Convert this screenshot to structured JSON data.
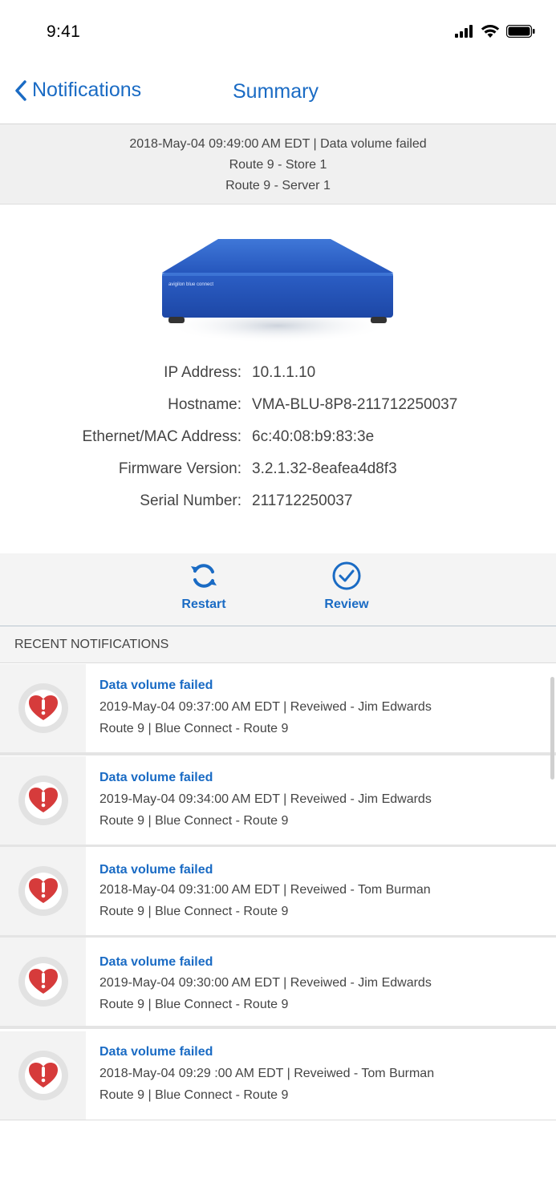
{
  "status_bar": {
    "time": "9:41"
  },
  "nav": {
    "back_label": "Notifications",
    "title": "Summary"
  },
  "summary": {
    "line1": "2018-May-04 09:49:00 AM EDT | Data volume failed",
    "line2": "Route 9 - Store 1",
    "line3": "Route 9 - Server 1"
  },
  "device": {
    "brand_text": "avigilon blue connect",
    "fields": [
      {
        "label": "IP Address:",
        "value": "10.1.1.10"
      },
      {
        "label": "Hostname:",
        "value": "VMA-BLU-8P8-211712250037"
      },
      {
        "label": "Ethernet/MAC Address:",
        "value": "6c:40:08:b9:83:3e"
      },
      {
        "label": "Firmware Version:",
        "value": "3.2.1.32-8eafea4d8f3"
      },
      {
        "label": "Serial Number:",
        "value": "211712250037"
      }
    ]
  },
  "actions": {
    "restart_label": "Restart",
    "review_label": "Review"
  },
  "recent": {
    "header": "RECENT NOTIFICATIONS",
    "items": [
      {
        "title": "Data volume failed",
        "line1": "2019-May-04 09:37:00 AM EDT | Reveiwed - Jim Edwards",
        "line2": "Route 9 | Blue Connect - Route 9"
      },
      {
        "title": "Data volume failed",
        "line1": "2019-May-04 09:34:00 AM EDT | Reveiwed - Jim Edwards",
        "line2": "Route 9 | Blue Connect - Route 9"
      },
      {
        "title": "Data volume failed",
        "line1": "2018-May-04 09:31:00 AM EDT | Reveiwed - Tom Burman",
        "line2": "Route 9 | Blue Connect - Route 9"
      },
      {
        "title": "Data volume failed",
        "line1": "2019-May-04 09:30:00 AM EDT | Reveiwed - Jim Edwards",
        "line2": "Route 9 | Blue Connect - Route 9"
      },
      {
        "title": "Data volume failed",
        "line1": "2018-May-04 09:29 :00 AM EDT | Reveiwed - Tom Burman",
        "line2": "Route 9 | Blue Connect - Route 9"
      }
    ]
  },
  "colors": {
    "accent": "#1a6bc4",
    "alert": "#d63b3b",
    "device_blue": "#2a5bc0"
  }
}
